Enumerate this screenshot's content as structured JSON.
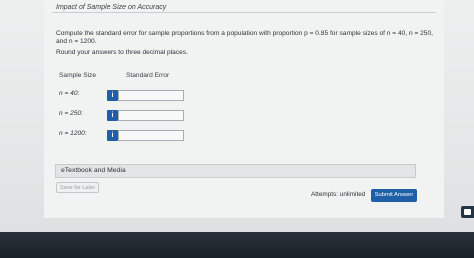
{
  "header": {
    "title": "Impact of Sample Size on Accuracy"
  },
  "question": {
    "text": "Compute the standard error for sample proportions from a population with proportion p = 0.85 for sample sizes of n = 40, n = 250, and n = 1200.",
    "instruction": "Round your answers to three decimal places."
  },
  "table": {
    "col_sample_size": "Sample Size",
    "col_standard_error": "Standard Error",
    "rows": [
      {
        "label": "n = 40:",
        "info": "i",
        "value": ""
      },
      {
        "label": "n = 250:",
        "info": "i",
        "value": ""
      },
      {
        "label": "n = 1200:",
        "info": "i",
        "value": ""
      }
    ]
  },
  "etextbook": {
    "label": "eTextbook and Media"
  },
  "footer": {
    "save_later": "Save for Later",
    "attempts": "Attempts: unlimited",
    "submit": "Submit Answer"
  },
  "colors": {
    "accent": "#1f5fa8",
    "bottom_bar": "#1b2128"
  }
}
